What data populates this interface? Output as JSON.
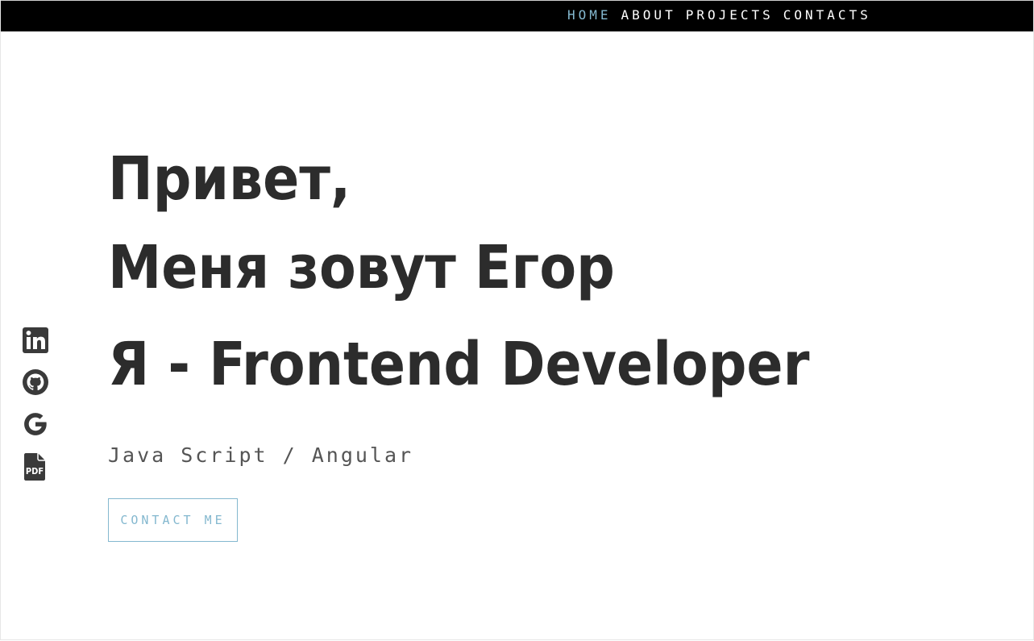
{
  "nav": {
    "items": [
      {
        "label": "HOME",
        "active": true
      },
      {
        "label": "ABOUT",
        "active": false
      },
      {
        "label": "PROJECTS",
        "active": false
      },
      {
        "label": "CONTACTS",
        "active": false
      }
    ]
  },
  "social": {
    "icons": [
      "linkedin-icon",
      "github-icon",
      "google-icon",
      "pdf-icon"
    ],
    "pdf_text": "PDF"
  },
  "hero": {
    "line1": "Привет,",
    "line2": "Меня зовут Егор",
    "line3": "Я - Frontend Developer",
    "subtitle": "Java Script / Angular",
    "cta_label": "CONTACT ME"
  },
  "colors": {
    "accent": "#84b8cf",
    "text": "#2c2c2c",
    "navbar_bg": "#000000",
    "icon": "#3a3a3a"
  }
}
